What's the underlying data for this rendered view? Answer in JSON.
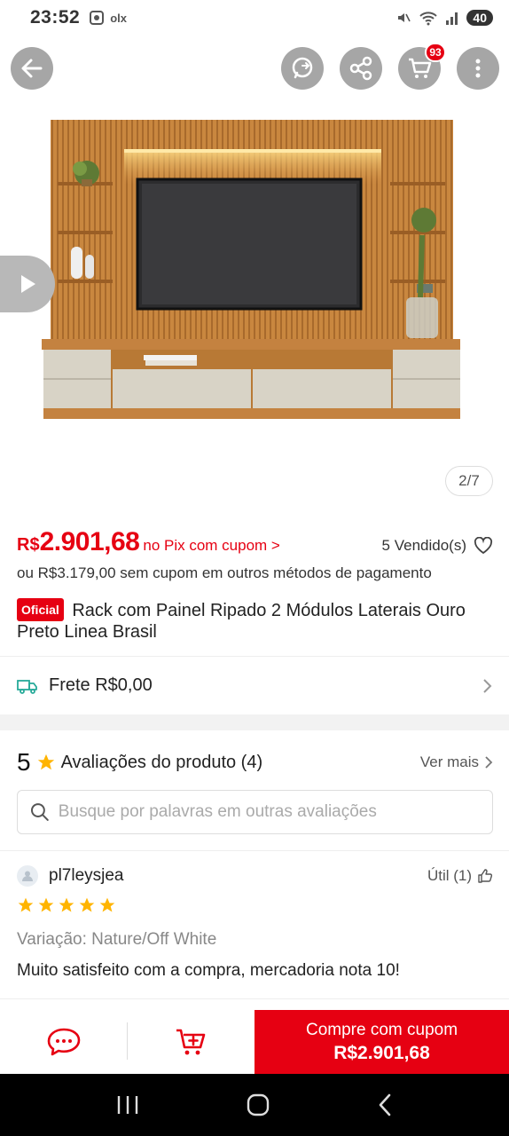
{
  "status_bar": {
    "time": "23:52",
    "left_icons": [
      "screenshot-icon",
      "olx-icon"
    ],
    "olx_text": "olx",
    "battery": "40"
  },
  "top_actions": {
    "cart_count": "93"
  },
  "gallery": {
    "counter": "2/7"
  },
  "product": {
    "price_currency": "R$",
    "price_value": "2.901,68",
    "pix_text": "no Pix com cupom >",
    "sold": "5 Vendido(s)",
    "alt_price": "ou R$3.179,00 sem cupom em outros métodos de pagamento",
    "official_badge": "Oficial",
    "title": "Rack com Painel Ripado 2 Módulos Laterais Ouro Preto Linea Brasil"
  },
  "shipping": {
    "label": "Frete R$0,00"
  },
  "reviews": {
    "score": "5",
    "title": "Avaliações do produto (4)",
    "see_more": "Ver mais",
    "search_placeholder": "Busque por palavras em outras avaliações",
    "items": [
      {
        "user": "pl7leysjea",
        "useful": "Útil (1)",
        "stars": 5,
        "variation": "Variação: Nature/Off White",
        "comment": "Muito satisfeito com a compra, mercadoria nota 10!"
      }
    ]
  },
  "bottom_bar": {
    "buy_line1": "Compre com cupom",
    "buy_line2": "R$2.901,68"
  },
  "colors": {
    "accent": "#e60012",
    "star": "#ffb400",
    "truck": "#26aa99"
  }
}
